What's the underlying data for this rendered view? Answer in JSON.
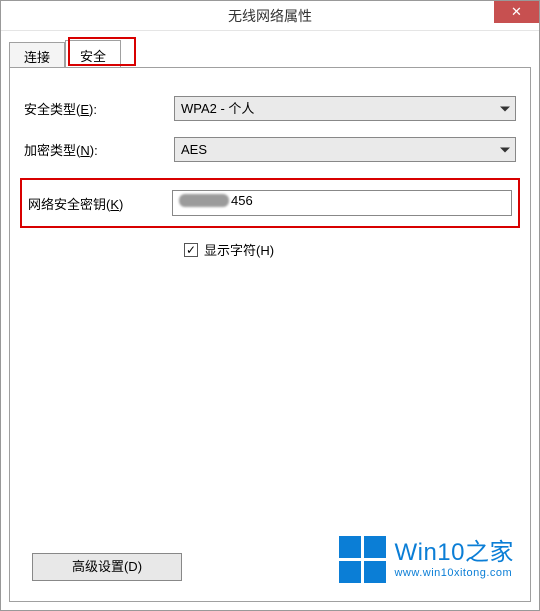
{
  "window": {
    "title": "无线网络属性",
    "close_glyph": "✕"
  },
  "tabs": {
    "connect": "连接",
    "security": "安全"
  },
  "form": {
    "security_type_label_pre": "安全类型(",
    "security_type_key": "E",
    "security_type_label_post": "):",
    "security_type_value": "WPA2 - 个人",
    "encryption_label_pre": "加密类型(",
    "encryption_key": "N",
    "encryption_label_post": "):",
    "encryption_value": "AES",
    "key_label_pre": "网络安全密钥(",
    "key_key": "K",
    "key_label_post": ")",
    "key_value_visible": "456",
    "show_chars_label_pre": "显示字符(",
    "show_chars_key": "H",
    "show_chars_label_post": ")",
    "show_chars_checked": "✓"
  },
  "buttons": {
    "advanced_pre": "高级设置(",
    "advanced_key": "D",
    "advanced_post": ")"
  },
  "watermark": {
    "line1": "Win10之家",
    "line2": "www.win10xitong.com"
  }
}
